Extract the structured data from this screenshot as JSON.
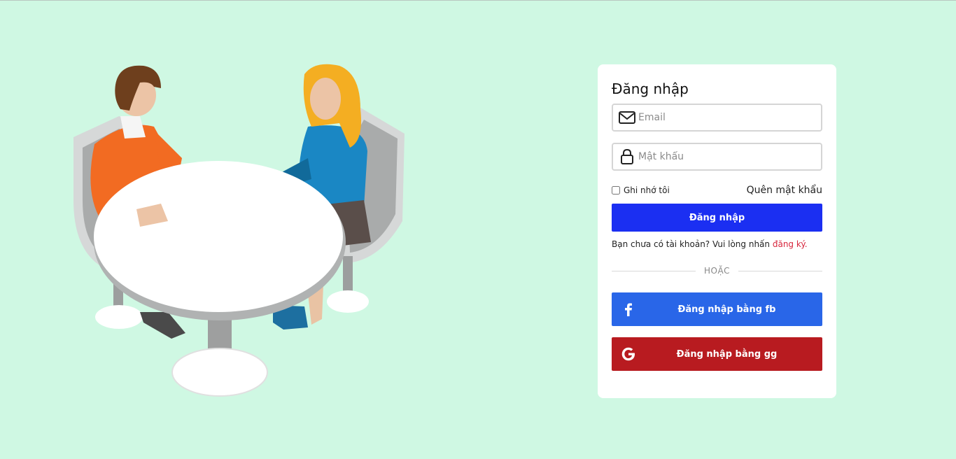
{
  "login_card": {
    "title": "Đăng nhập",
    "email_placeholder": "Email",
    "password_placeholder": "Mật khẩu",
    "remember_label": "Ghi nhớ tôi",
    "forgot_label": "Quên mật khẩu",
    "login_button": "Đăng nhập",
    "signup_prompt": "Bạn chưa có tài khoản? Vui lòng nhấn",
    "signup_link": "đăng ký.",
    "divider_text": "HOẶC",
    "facebook_button": "Đăng nhập bằng fb",
    "google_button": "Đăng nhập bằng gg"
  },
  "icons": {
    "email": "mail-icon",
    "password": "lock-icon",
    "facebook": "facebook-icon",
    "google": "google-icon"
  },
  "colors": {
    "background": "#cff8e3",
    "login_button": "#1b2ff2",
    "facebook_button": "#2966e8",
    "google_button": "#b81b20",
    "signup_link": "#d7263d"
  }
}
